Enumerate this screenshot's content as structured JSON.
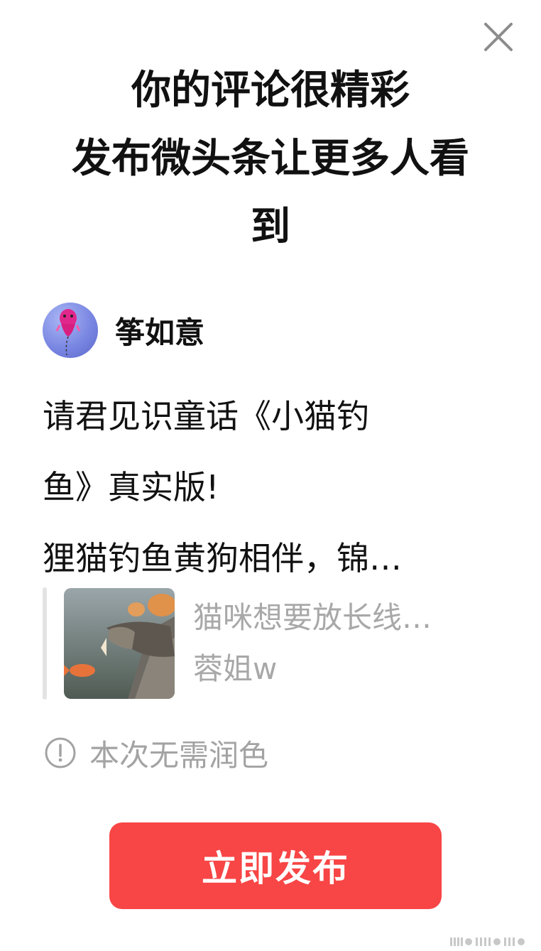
{
  "dialog": {
    "headline_lines": [
      "你的评论很精彩",
      "发布微头条让更多人看",
      "到"
    ]
  },
  "author": {
    "name": "筝如意"
  },
  "comment": {
    "lines": [
      "请君见识童话《小猫钓",
      "鱼》真实版!",
      "狸猫钓鱼黄狗相伴，锦…"
    ]
  },
  "quoted": {
    "title": "猫咪想要放长线…",
    "author": "蓉姐w"
  },
  "notice": {
    "text": "本次无需润色"
  },
  "actions": {
    "publish_label": "立即发布"
  },
  "colors": {
    "primary_button": "#f84545",
    "muted_text": "#a8a8a8"
  }
}
